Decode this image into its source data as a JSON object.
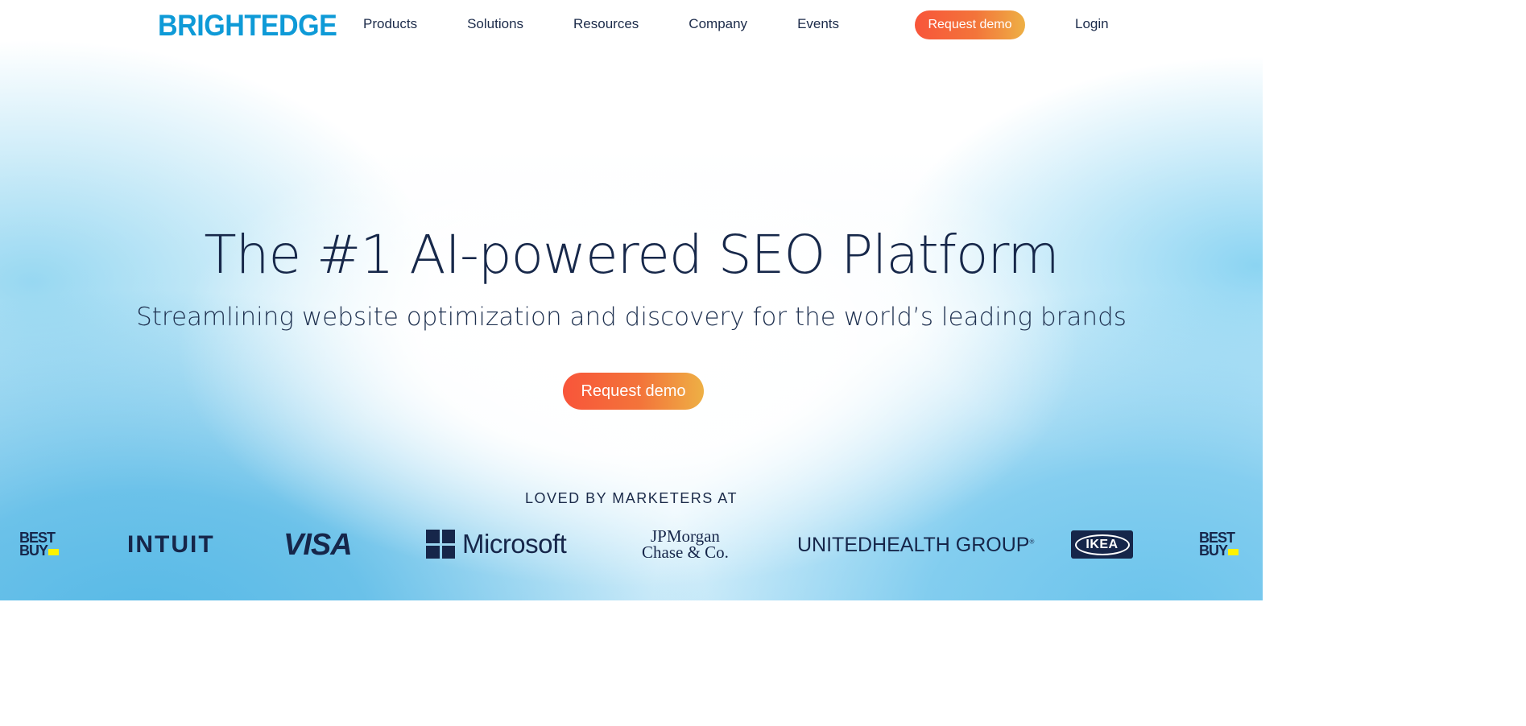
{
  "nav": {
    "logo": "BRIGHTEDGE",
    "menu": [
      "Products",
      "Solutions",
      "Resources",
      "Company",
      "Events"
    ],
    "demo_label": "Request demo",
    "login_label": "Login"
  },
  "hero": {
    "title": "The #1 AI-powered SEO Platform",
    "subtitle": "Streamlining website optimization and discovery for the world’s leading brands",
    "cta_label": "Request demo"
  },
  "logos": {
    "heading": "LOVED BY MARKETERS AT",
    "brands": [
      {
        "name": "Best Buy",
        "line1": "BEST",
        "line2": "BUY"
      },
      {
        "name": "Intuit",
        "text": "INTUIT"
      },
      {
        "name": "Visa",
        "text": "VISA"
      },
      {
        "name": "Microsoft",
        "text": "Microsoft"
      },
      {
        "name": "JPMorgan Chase & Co.",
        "line1": "JPMorgan",
        "line2": "Chase & Co."
      },
      {
        "name": "UnitedHealth Group",
        "text": "UNITEDHEALTH GROUP"
      },
      {
        "name": "IKEA",
        "text": "IKEA"
      },
      {
        "name": "Best Buy",
        "line1": "BEST",
        "line2": "BUY"
      }
    ]
  },
  "colors": {
    "brand": "#0e9ad7",
    "navy": "#17284a",
    "cta_start": "#f8553a",
    "cta_end": "#eeb045",
    "bg_blue": "#57b9e6"
  }
}
